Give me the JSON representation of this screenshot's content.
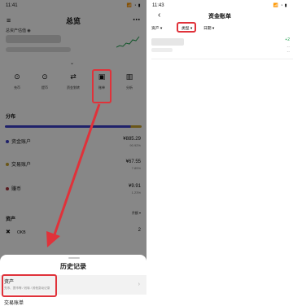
{
  "left": {
    "status_time": "11:41",
    "status_icons": "📶 ◔ ▮",
    "menu_icon": "menu-icon",
    "more_icon": "more-icon",
    "page_title": "总览",
    "total_label": "总资产估值 ◉",
    "quick_actions": [
      {
        "icon": "deposit-icon",
        "label": "充币"
      },
      {
        "icon": "withdraw-icon",
        "label": "提币"
      },
      {
        "icon": "transfer-icon",
        "label": "资金划转"
      },
      {
        "icon": "bill-icon",
        "label": "账单"
      },
      {
        "icon": "analysis-icon",
        "label": "分析"
      }
    ],
    "distribution_title": "分布",
    "distribution": [
      {
        "name": "资金账户",
        "amount": "¥885.29",
        "percent": "90.92%",
        "color": "#3b3fc9"
      },
      {
        "name": "交易账户",
        "amount": "¥67.55",
        "percent": "7.85%",
        "color": "#c9a22e"
      },
      {
        "name": "赚币",
        "amount": "¥9.91",
        "percent": "1.23%",
        "color": "#a8313a"
      }
    ],
    "assets_title": "资产",
    "assets_filter": "余额 ▾",
    "asset_rows": [
      {
        "icon": "okb-icon",
        "name": "OKB",
        "value": "2"
      }
    ],
    "sheet": {
      "title": "历史记录",
      "items": [
        {
          "label": "资产",
          "sub": "充币、提币等 / 划转 / 其他变动记录"
        },
        {
          "label": "交易账单"
        }
      ]
    }
  },
  "right": {
    "status_time": "11:43",
    "status_icons": "📶 ◔ ▮",
    "title": "资金账单",
    "back_icon": "back-arrow-icon",
    "filters": [
      {
        "label": "资产 ▾"
      },
      {
        "label": "类型 ▾"
      },
      {
        "label": "日期 ▾"
      }
    ],
    "item": {
      "value": "+2",
      "dash1": "--",
      "dash2": "--"
    }
  },
  "highlight_color": "#e0323a"
}
